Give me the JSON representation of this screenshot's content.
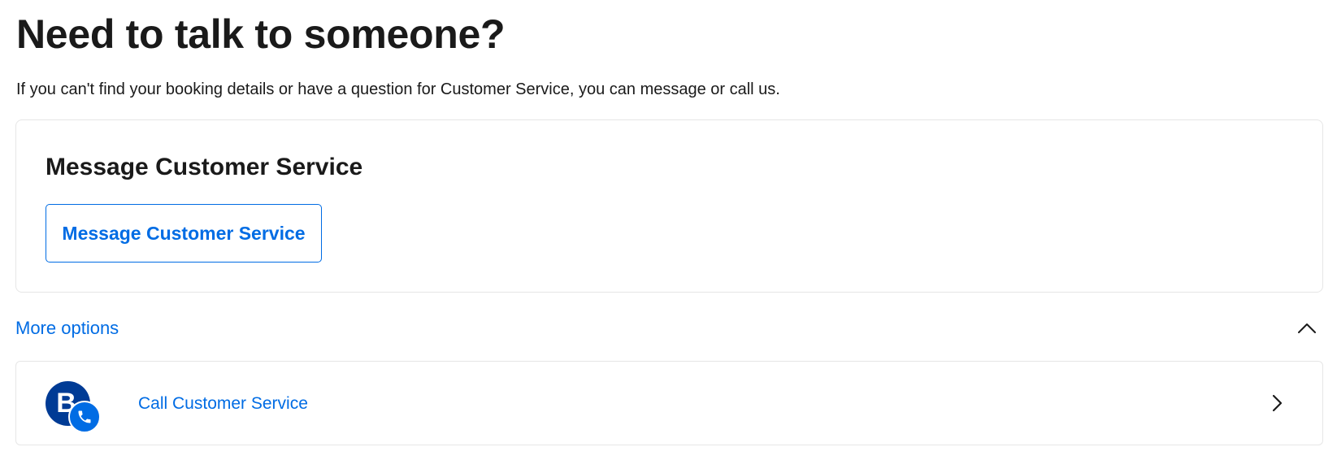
{
  "header": {
    "title": "Need to talk to someone?",
    "intro": "If you can't find your booking details or have a question for Customer Service, you can message or call us."
  },
  "message_card": {
    "title": "Message Customer Service",
    "button_label": "Message Customer Service"
  },
  "more_options": {
    "label": "More options",
    "expanded": true,
    "toggle_icon": "chevron-up-icon"
  },
  "call_option": {
    "label": "Call Customer Service",
    "avatar_letter": "B",
    "avatar_icon": "phone-icon",
    "arrow_icon": "chevron-right-icon"
  },
  "colors": {
    "link": "#006ce4",
    "brand_dark": "#003b95",
    "text": "#1a1a1a",
    "border": "#e6e6e6"
  }
}
